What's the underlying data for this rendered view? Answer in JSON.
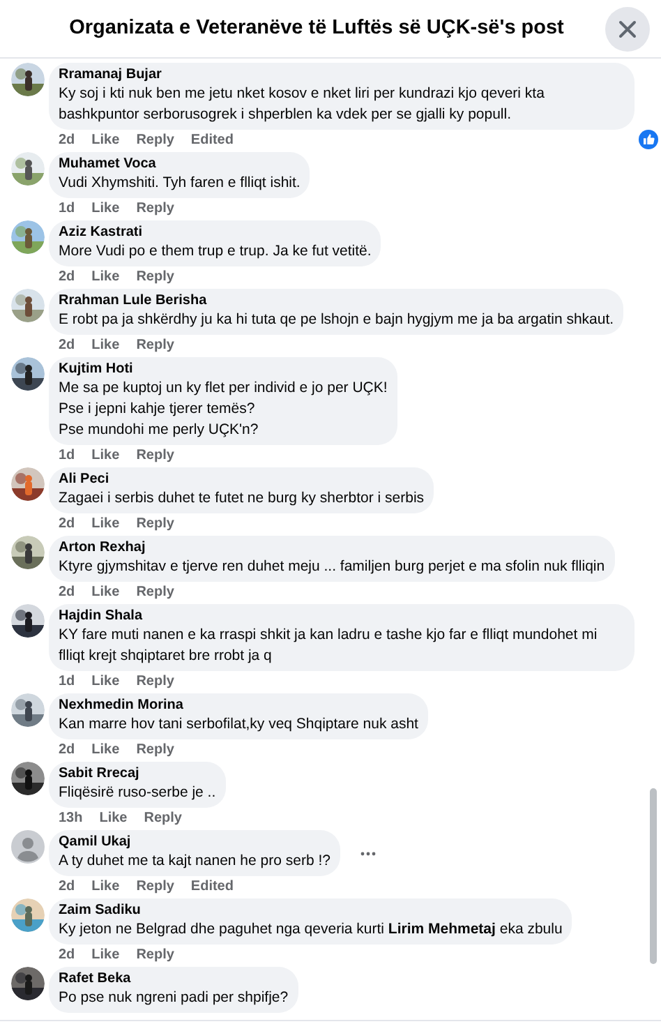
{
  "header": {
    "title": "Organizata e Veteranëve të Luftës së UÇK-së's post"
  },
  "comments": [
    {
      "default_avatar": false,
      "name": "Rramanaj Bujar",
      "text": "Ky soj i kti nuk ben me jetu nket kosov e nket liri per kundrazi kjo qeveri kta bashkpuntor serborusogrek i shperblen ka vdek per se gjalli ky popull.",
      "actions": [
        "2d",
        "Like",
        "Reply",
        "Edited"
      ],
      "liked": true,
      "more": false
    },
    {
      "default_avatar": false,
      "name": "Muhamet Voca",
      "text": "Vudi Xhymshiti. Tyh faren e flliqt ishit.",
      "actions": [
        "1d",
        "Like",
        "Reply"
      ],
      "liked": false,
      "more": false
    },
    {
      "default_avatar": false,
      "name": "Aziz Kastrati",
      "text": "More Vudi po e them trup e trup. Ja ke fut vetitë.",
      "actions": [
        "2d",
        "Like",
        "Reply"
      ],
      "liked": false,
      "more": false
    },
    {
      "default_avatar": false,
      "name": "Rrahman Lule Berisha",
      "text": "E robt pa ja shkërdhy ju ka hi tuta qe pe lshojn e bajn hygjym me ja ba argatin shkaut.",
      "actions": [
        "2d",
        "Like",
        "Reply"
      ],
      "liked": false,
      "more": false
    },
    {
      "default_avatar": false,
      "name": "Kujtim Hoti",
      "text": "Me sa pe kuptoj un ky flet per individ e jo per UÇK!\nPse i jepni kahje tjerer temës?\nPse mundohi me perly UÇK'n?",
      "actions": [
        "1d",
        "Like",
        "Reply"
      ],
      "liked": false,
      "more": false
    },
    {
      "default_avatar": false,
      "name": "Ali Peci",
      "text": "Zagaei i serbis duhet te futet ne burg ky sherbtor i serbis",
      "actions": [
        "2d",
        "Like",
        "Reply"
      ],
      "liked": false,
      "more": false
    },
    {
      "default_avatar": false,
      "name": "Arton Rexhaj",
      "text": "Ktyre gjymshitav e tjerve ren duhet meju ... familjen burg perjet e ma sfolin nuk flliqin",
      "actions": [
        "2d",
        "Like",
        "Reply"
      ],
      "liked": false,
      "more": false
    },
    {
      "default_avatar": false,
      "name": "Hajdin Shala",
      "text": "KY fare muti nanen e ka rraspi shkit ja kan ladru e tashe kjo far e flliqt mundohet mi flliqt krejt shqiptaret bre rrobt ja q",
      "actions": [
        "1d",
        "Like",
        "Reply"
      ],
      "liked": false,
      "more": false
    },
    {
      "default_avatar": false,
      "name": "Nexhmedin Morina",
      "text": "Kan marre hov tani serbofilat,ky veq Shqiptare nuk asht",
      "actions": [
        "2d",
        "Like",
        "Reply"
      ],
      "liked": false,
      "more": false
    },
    {
      "default_avatar": false,
      "name": "Sabit Rrecaj",
      "text": "Fliqësirë ruso-serbe je ..",
      "actions": [
        "13h",
        "Like",
        "Reply"
      ],
      "liked": false,
      "more": false
    },
    {
      "default_avatar": true,
      "name": "Qamil Ukaj",
      "text": "A ty duhet me ta kajt nanen he pro serb !?",
      "actions": [
        "2d",
        "Like",
        "Reply",
        "Edited"
      ],
      "liked": false,
      "more": true
    },
    {
      "default_avatar": false,
      "name": "Zaim Sadiku",
      "text": "Ky jeton ne Belgrad dhe paguhet nga qeveria kurti **Lirim Mehmetaj** eka zbulu",
      "actions": [
        "2d",
        "Like",
        "Reply"
      ],
      "liked": false,
      "more": false
    },
    {
      "default_avatar": false,
      "name": "Rafet Beka",
      "text": "Po pse nuk ngreni padi per shpifje?",
      "liked": false,
      "more": false
    }
  ]
}
